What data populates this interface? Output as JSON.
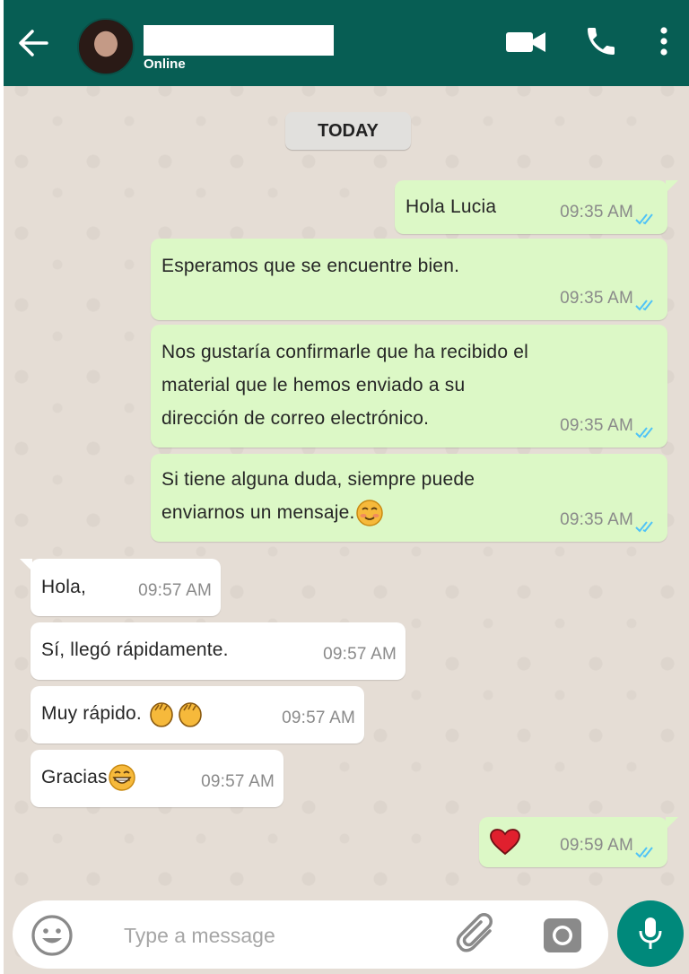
{
  "header": {
    "status": "Online"
  },
  "date_divider": "TODAY",
  "messages": [
    {
      "dir": "out",
      "lines": [
        "Hola Lucia"
      ],
      "time": "09:35 AM"
    },
    {
      "dir": "out",
      "lines": [
        "Esperamos que se encuentre bien."
      ],
      "time": "09:35 AM"
    },
    {
      "dir": "out",
      "lines": [
        "Nos gustaría confirmarle que ha recibido el",
        "material que le hemos enviado a su",
        "dirección de correo electrónico."
      ],
      "time": "09:35 AM"
    },
    {
      "dir": "out",
      "lines": [
        "Si tiene alguna duda, siempre puede",
        "enviarnos un mensaje."
      ],
      "time": "09:35 AM",
      "emoji": "blushing-face"
    },
    {
      "dir": "in",
      "lines": [
        "Hola,"
      ],
      "time": "09:57 AM"
    },
    {
      "dir": "in",
      "lines": [
        "Sí, llegó rápidamente."
      ],
      "time": "09:57 AM"
    },
    {
      "dir": "in",
      "lines": [
        "Muy rápido."
      ],
      "time": "09:57 AM",
      "emoji": "clapping-hands"
    },
    {
      "dir": "in",
      "lines": [
        "Gracias"
      ],
      "time": "09:57 AM",
      "emoji": "grinning-face"
    },
    {
      "dir": "out",
      "lines": [
        ""
      ],
      "time": "09:59 AM",
      "emoji": "red-heart"
    }
  ],
  "composer": {
    "placeholder": "Type a message"
  },
  "icons": {
    "back": "back-arrow-icon",
    "video": "video-camera-icon",
    "call": "phone-icon",
    "menu": "more-vertical-icon",
    "emoji": "smiley-icon",
    "attach": "paperclip-icon",
    "camera": "camera-icon",
    "mic": "microphone-icon",
    "read": "double-check-icon"
  },
  "colors": {
    "header": "#075e54",
    "wallpaper": "#e5ddd5",
    "outgoing": "#dcf8c6",
    "incoming": "#ffffff",
    "read_tick": "#4fc3f7",
    "mic_button": "#00897b"
  }
}
